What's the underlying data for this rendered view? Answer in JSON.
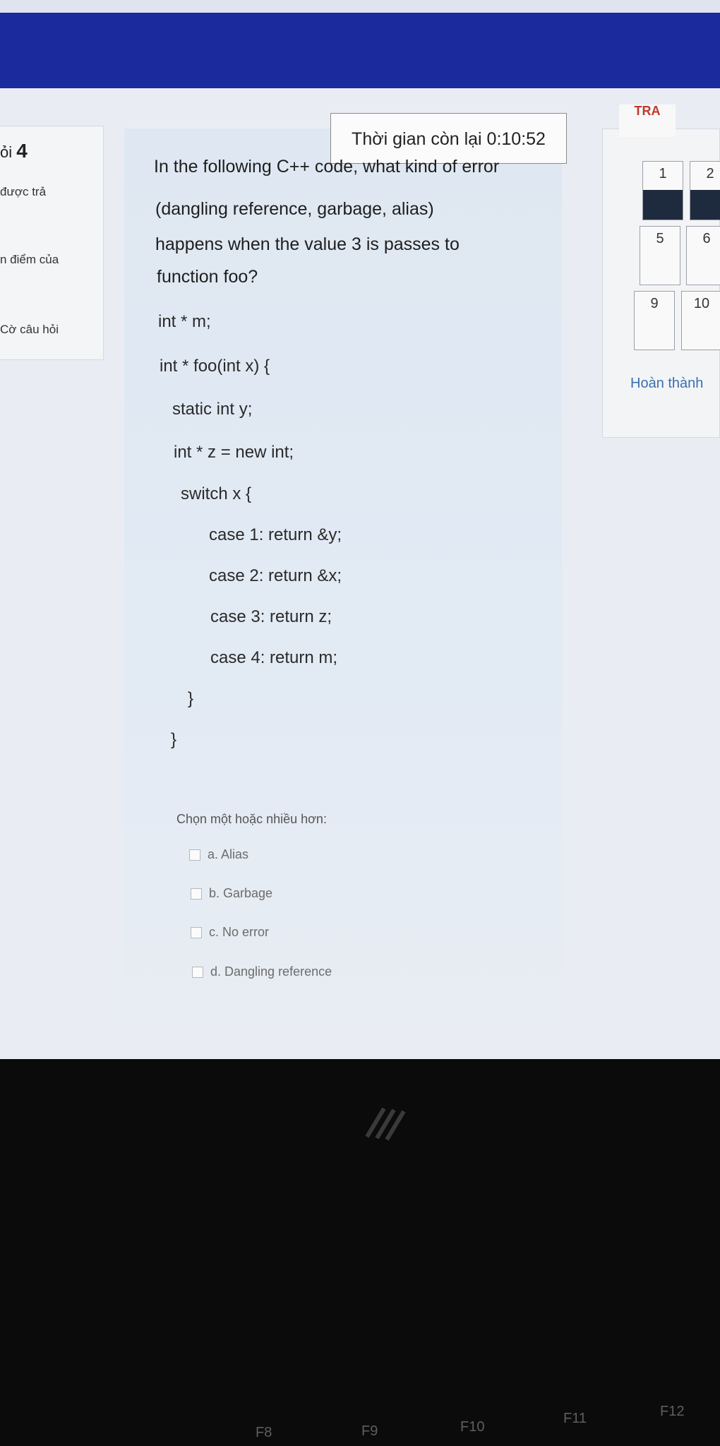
{
  "sidebar": {
    "question_label": "ỏi",
    "question_number": "4",
    "status_text": "được trả",
    "points_text": "n điểm của",
    "flag_text": "Cờ câu hỏi"
  },
  "timer": {
    "text": "Thời gian còn lại 0:10:52"
  },
  "question": {
    "lines": [
      "In the following C++ code, what kind of error",
      "(dangling reference, garbage, alias)",
      "happens when the value 3 is passes to",
      "function foo?"
    ],
    "code": [
      "int * m;",
      "int * foo(int x) {",
      "static int y;",
      "int * z = new int;",
      "switch x {",
      "case 1: return &y;",
      "case 2: return &x;",
      "case 3: return z;",
      "case 4: return m;",
      "}",
      "}"
    ],
    "prompt": "Chọn một hoặc nhiều hơn:",
    "options": [
      "a. Alias",
      "b. Garbage",
      "c. No error",
      "d. Dangling reference"
    ]
  },
  "navigation": {
    "title": "TRA",
    "buttons": [
      {
        "label": "1",
        "answered": true
      },
      {
        "label": "2",
        "answered": true
      },
      {
        "label": "5",
        "answered": false
      },
      {
        "label": "6",
        "answered": false
      },
      {
        "label": "9",
        "answered": false
      },
      {
        "label": "10",
        "answered": false
      }
    ],
    "finish_link": "Hoàn thành"
  },
  "keyboard": {
    "keys": [
      "F8",
      "F9",
      "F10",
      "F11",
      "F12"
    ]
  },
  "colors": {
    "header_blue": "#1b2a9c",
    "answered_fill": "#1e2a3e",
    "link": "#3a6fb0"
  }
}
